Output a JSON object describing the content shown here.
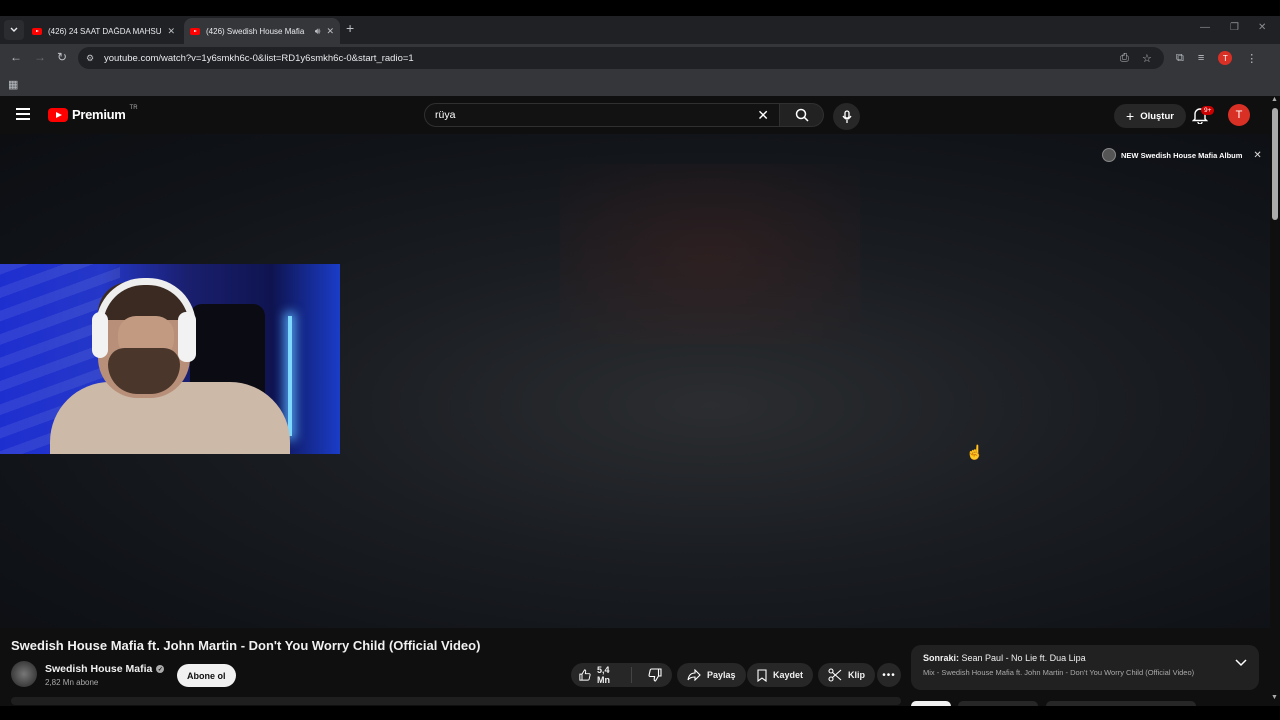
{
  "browser": {
    "tabs": [
      {
        "title": "(426) 24 SAAT DAĞDA MAHSUR",
        "active": false
      },
      {
        "title": "(426) Swedish House Mafia",
        "active": true,
        "audio": true
      }
    ],
    "url": "youtube.com/watch?v=1y6smkh6c-0&list=RD1y6smkh6c-0&start_radio=1",
    "profile_initial": "T"
  },
  "header": {
    "logo_text": "Premium",
    "logo_region": "TR",
    "search_value": "rüya",
    "create_label": "Oluştur",
    "notification_badge": "9+",
    "avatar_initial": "T"
  },
  "player": {
    "promo_text": "NEW Swedish House Mafia Album"
  },
  "video": {
    "title": "Swedish House Mafia ft. John Martin - Don't You Worry Child (Official Video)",
    "channel_name": "Swedish House Mafia",
    "subscribers": "2,82 Mn abone",
    "subscribe_label": "Abone ol",
    "likes": "5,4 Mn",
    "share_label": "Paylaş",
    "save_label": "Kaydet",
    "clip_label": "Klip"
  },
  "up_next": {
    "prefix": "Sonraki:",
    "title": "Sean Paul - No Lie ft. Dua Lipa",
    "subtitle": "Mix - Swedish House Mafia ft. John Martin - Don't You Worry Child (Official Video)"
  },
  "icons": {
    "accent": "#ff0000",
    "avatar_color": "#d93025"
  }
}
